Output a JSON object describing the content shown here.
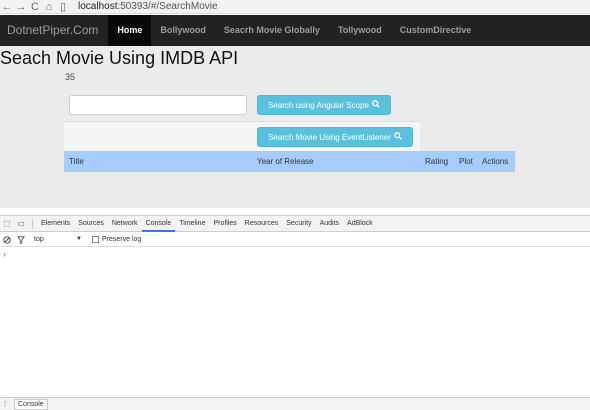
{
  "browser": {
    "back": "←",
    "forward": "→",
    "reload": "C",
    "home": "⌂",
    "page_icon": "▯",
    "url_host": "localhost",
    "url_path": ":50393/#/SearchMovie"
  },
  "navbar": {
    "brand": "DotnetPiper.Com",
    "items": [
      {
        "label": "Home"
      },
      {
        "label": "Bollywood"
      },
      {
        "label": "Seacrh Movie Globally"
      },
      {
        "label": "Tollywood"
      },
      {
        "label": "CustomDirective"
      }
    ]
  },
  "main": {
    "title": "Seach Movie Using IMDB API",
    "count": "35",
    "search": {
      "value": "",
      "placeholder": ""
    },
    "btn_scope": "Search using Angular Scope",
    "btn_event": "Search Movie Using EventListener",
    "search_icon": "search-icon",
    "table_headers": [
      "Title",
      "Year of Release",
      "Rating",
      "Plot",
      "Actions"
    ]
  },
  "devtools": {
    "inspect_icon": "⬚",
    "device_icon": "▭",
    "tabs": [
      "Elements",
      "Sources",
      "Network",
      "Console",
      "Timeline",
      "Profiles",
      "Resources",
      "Security",
      "Audits",
      "AdBlock"
    ],
    "active_tab": "Console",
    "context": "top",
    "context_arrow": "▼",
    "preserve_log": "Preserve log",
    "prompt": "›",
    "drawer_tab": "Console",
    "drawer_menu": "⋮"
  },
  "colors": {
    "navbar_bg": "#222222",
    "button_bg": "#5bc0de",
    "table_header_bg": "#a6cbff",
    "page_bg": "#ebebeb"
  }
}
